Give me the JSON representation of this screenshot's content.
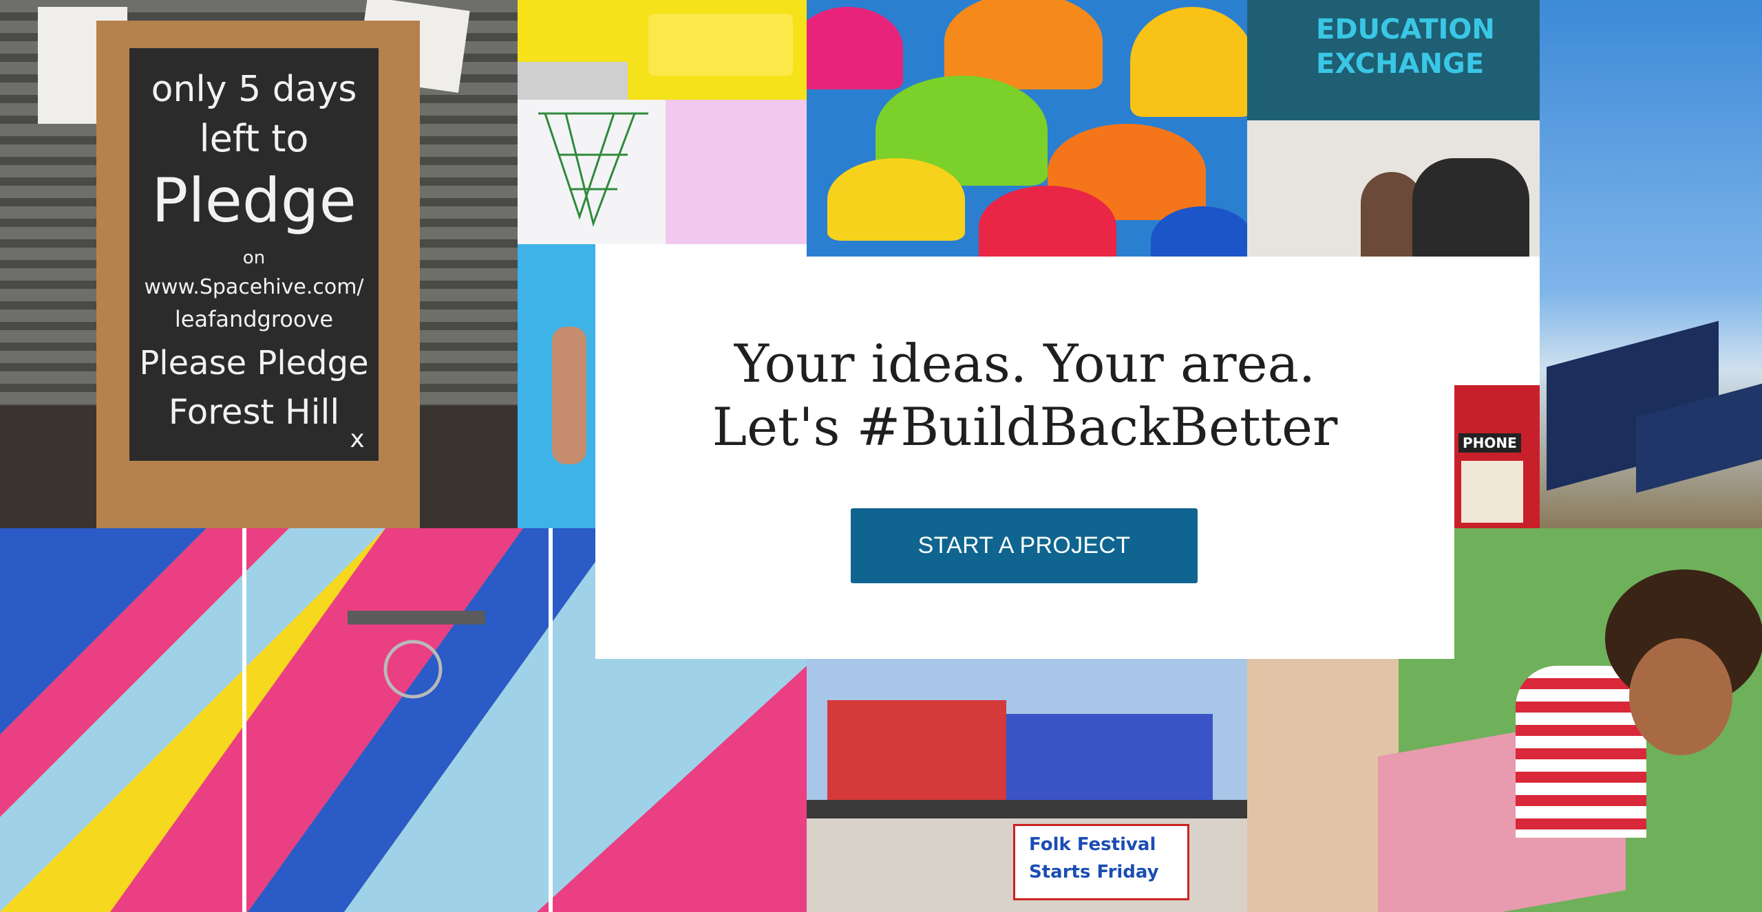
{
  "hero": {
    "line1": "Your ideas. Your area.",
    "line2": "Let's #BuildBackBetter",
    "cta_label": "START A PROJECT"
  },
  "photos": {
    "chalkboard": [
      "only 5 days",
      "left to",
      "Pledge",
      "on",
      "www.Spacehive.com/",
      "leafandgroove",
      "Please Pledge",
      "Forest Hill",
      "x"
    ],
    "education_sign": [
      "EDUCATION",
      "EXCHANGE"
    ],
    "phone_sign": "PHONE",
    "festival_banner": [
      "Folk Festival",
      "Starts Friday"
    ]
  },
  "colors": {
    "cta": "#0f6590",
    "heading": "#1f1f1f"
  }
}
